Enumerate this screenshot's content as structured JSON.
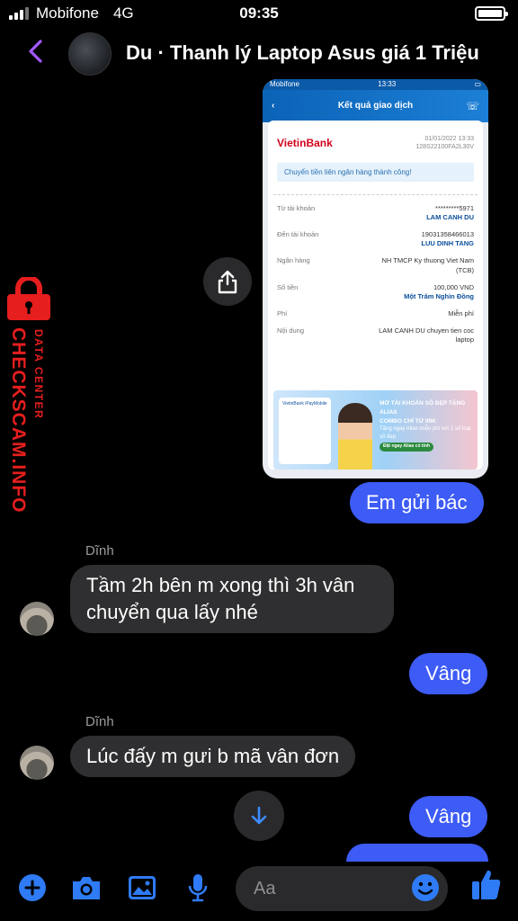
{
  "status_bar": {
    "carrier": "Mobifone",
    "network": "4G",
    "time": "09:35"
  },
  "header": {
    "title": "Du · Thanh lý Laptop Asus giá 1 Triệu"
  },
  "shared_image": {
    "status_carrier": "Mobifone",
    "status_time": "13:33",
    "title": "Kết quả giao dịch",
    "bank_logo": "VietinBank",
    "date": "01/01/2022 13:33",
    "ref": "128S22100FA2L30V",
    "success_message": "Chuyển tiền liên ngân hàng thành công!",
    "details": [
      {
        "label": "Từ tài khoản",
        "value": "*********5971",
        "value2": "LAM CANH DU"
      },
      {
        "label": "Đến tài khoản",
        "value": "19031358466013",
        "value2": "LUU DINH TANG"
      },
      {
        "label": "Ngân hàng",
        "value": "NH TMCP Ky thuong Viet Nam (TCB)",
        "value2": ""
      },
      {
        "label": "Số tiền",
        "value": "100,000 VND",
        "value2": "Một Trăm Nghìn Đồng"
      },
      {
        "label": "Phí",
        "value": "Miễn phí",
        "value2": ""
      },
      {
        "label": "Nội dung",
        "value": "LAM CANH DU chuyen tien coc laptop",
        "value2": ""
      }
    ],
    "promo_app": "VietinBank iPayMobile",
    "promo_line1": "MỞ TÀI KHOẢN SỐ ĐẸP TẶNG ALIAS",
    "promo_line2": "COMBO CHỈ TỪ 99K",
    "promo_line3": "Tặng ngay Alias miễn phí với 1 số loại số đẹp",
    "promo_button": "Đặt ngay Alias có tính"
  },
  "watermark": {
    "main": "CHECKSCAM.INFO",
    "sub": "DATA CENTER"
  },
  "messages": {
    "m1": "Em gửi bác",
    "sender1": "Dĩnh",
    "m2": "Tầm 2h bên m xong thì 3h vân chuyển qua lấy nhé",
    "m3": "Vâng",
    "sender2": "Dĩnh",
    "m4": "Lúc đấy m gưi b mã vân đơn",
    "m5": "Vâng"
  },
  "composer": {
    "placeholder": "Aa"
  },
  "colors": {
    "accent": "#3d5bf5",
    "back_arrow": "#a259ff",
    "toolbar_icons": "#2f7bf5",
    "watermark": "#e61e1e"
  },
  "icons": [
    "back-icon",
    "share-icon",
    "lock-icon",
    "arrow-down-icon",
    "plus-icon",
    "camera-icon",
    "image-icon",
    "mic-icon",
    "emoji-icon",
    "thumbs-up-icon"
  ]
}
